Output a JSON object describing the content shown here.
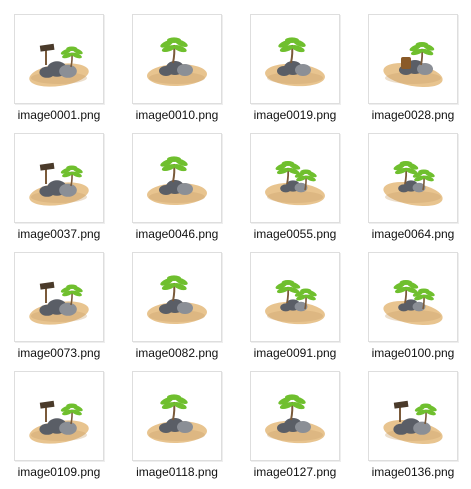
{
  "files": [
    {
      "name": "image0001.png",
      "icon": "island-rocks-signpost-icon"
    },
    {
      "name": "image0010.png",
      "icon": "island-rocks-palm-icon"
    },
    {
      "name": "image0019.png",
      "icon": "island-rocks-palm-icon"
    },
    {
      "name": "image0028.png",
      "icon": "island-rocks-barrel-icon"
    },
    {
      "name": "image0037.png",
      "icon": "island-rocks-signpost-icon"
    },
    {
      "name": "image0046.png",
      "icon": "island-rocks-palm-icon"
    },
    {
      "name": "image0055.png",
      "icon": "island-topdown-palm-icon"
    },
    {
      "name": "image0064.png",
      "icon": "island-topdown-palm-icon"
    },
    {
      "name": "image0073.png",
      "icon": "island-rocks-signpost-icon"
    },
    {
      "name": "image0082.png",
      "icon": "island-rocks-palm-icon"
    },
    {
      "name": "image0091.png",
      "icon": "island-topdown-palm-icon"
    },
    {
      "name": "image0100.png",
      "icon": "island-topdown-palm-icon"
    },
    {
      "name": "image0109.png",
      "icon": "island-rocks-signpost-icon"
    },
    {
      "name": "image0118.png",
      "icon": "island-rocks-palm-icon"
    },
    {
      "name": "image0127.png",
      "icon": "island-rocks-palm-icon"
    },
    {
      "name": "image0136.png",
      "icon": "island-rocks-signpost-icon"
    }
  ],
  "colors": {
    "sand": "#e8c48f",
    "sand_dark": "#c9a06a",
    "rock": "#5a5e66",
    "rock_light": "#8b8f96",
    "palm": "#6fbf2e",
    "palm_dark": "#3f8a1d",
    "wood": "#7a5a3a",
    "barrel": "#8a5a28"
  }
}
